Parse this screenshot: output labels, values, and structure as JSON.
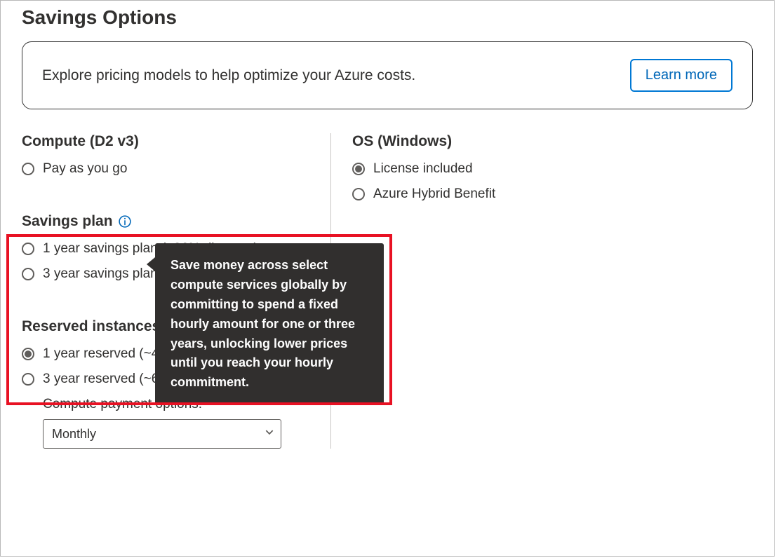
{
  "title": "Savings Options",
  "banner": {
    "text": "Explore pricing models to help optimize your Azure costs.",
    "cta": "Learn more"
  },
  "compute": {
    "heading": "Compute (D2 v3)",
    "options": {
      "payg": "Pay as you go"
    }
  },
  "savings_plan": {
    "heading": "Savings plan",
    "options": {
      "one_year": "1 year savings plan (~26% discount)",
      "three_year": "3 year savings plan (~47% discount)"
    },
    "tooltip": "Save money across select compute services globally by committing to spend a fixed hourly amount for one or three years, unlocking lower prices until you reach your hourly commitment."
  },
  "reserved": {
    "heading": "Reserved instances",
    "options": {
      "one_year": "1 year reserved (~40% discount)",
      "three_year": "3 year reserved (~62% discount)"
    },
    "payment_label": "Compute payment options:",
    "payment_value": "Monthly"
  },
  "os": {
    "heading": "OS (Windows)",
    "options": {
      "license": "License included",
      "hybrid": "Azure Hybrid Benefit"
    }
  }
}
